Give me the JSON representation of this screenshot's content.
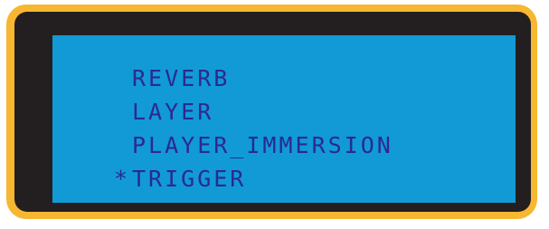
{
  "display": {
    "menu": {
      "items": [
        {
          "label": "REVERB",
          "selected": false
        },
        {
          "label": "LAYER",
          "selected": false
        },
        {
          "label": "PLAYER_IMMERSION",
          "selected": false
        },
        {
          "label": "TRIGGER",
          "selected": true
        }
      ],
      "cursor_symbol": "*"
    }
  },
  "colors": {
    "bezel": "#f7b731",
    "frame": "#231f20",
    "screen": "#129ad6",
    "text": "#2a2a8f"
  }
}
